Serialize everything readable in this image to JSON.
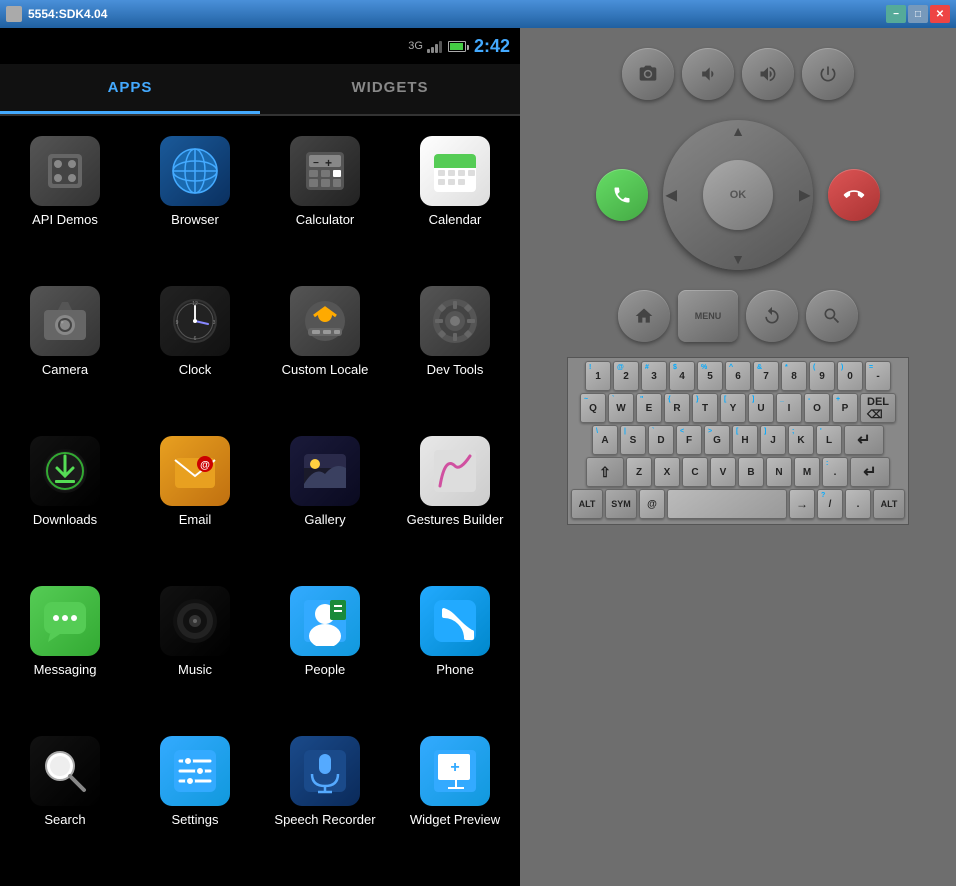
{
  "titlebar": {
    "title": "5554:SDK4.04",
    "min_label": "−",
    "max_label": "□",
    "close_label": "✕"
  },
  "status_bar": {
    "signal": "3G",
    "time": "2:42"
  },
  "tabs": [
    {
      "id": "apps",
      "label": "APPS",
      "active": true
    },
    {
      "id": "widgets",
      "label": "WIDGETS",
      "active": false
    }
  ],
  "apps": [
    {
      "id": "api-demos",
      "label": "API Demos"
    },
    {
      "id": "browser",
      "label": "Browser"
    },
    {
      "id": "calculator",
      "label": "Calculator"
    },
    {
      "id": "calendar",
      "label": "Calendar"
    },
    {
      "id": "camera",
      "label": "Camera"
    },
    {
      "id": "clock",
      "label": "Clock"
    },
    {
      "id": "custom-locale",
      "label": "Custom Locale"
    },
    {
      "id": "dev-tools",
      "label": "Dev Tools"
    },
    {
      "id": "downloads",
      "label": "Downloads"
    },
    {
      "id": "email",
      "label": "Email"
    },
    {
      "id": "gallery",
      "label": "Gallery"
    },
    {
      "id": "gestures-builder",
      "label": "Gestures Builder"
    },
    {
      "id": "messaging",
      "label": "Messaging"
    },
    {
      "id": "music",
      "label": "Music"
    },
    {
      "id": "people",
      "label": "People"
    },
    {
      "id": "phone",
      "label": "Phone"
    },
    {
      "id": "search",
      "label": "Search"
    },
    {
      "id": "settings",
      "label": "Settings"
    },
    {
      "id": "speech-recorder",
      "label": "Speech Recorder"
    },
    {
      "id": "widget-preview",
      "label": "Widget Preview"
    }
  ],
  "controls": {
    "camera_label": "📷",
    "vol_down_label": "🔉",
    "vol_up_label": "🔊",
    "power_label": "⏻",
    "call_label": "📞",
    "end_label": "📵",
    "home_label": "⌂",
    "menu_label": "MENU",
    "back_label": "↺",
    "search_label": "🔍"
  },
  "keyboard": {
    "rows": [
      [
        "!",
        "@",
        "#",
        "$",
        "%",
        "^",
        "&",
        "*",
        "(",
        ")",
        "-"
      ],
      [
        "1",
        "2",
        "3",
        "4",
        "5",
        "6",
        "7",
        "8",
        "9",
        "0",
        "="
      ],
      [
        "Q",
        "W",
        "E",
        "R",
        "T",
        "Y",
        "U",
        "I",
        "O",
        "P",
        "←"
      ],
      [
        "A",
        "S",
        "D",
        "F",
        "G",
        "H",
        "J",
        "K",
        "L",
        "⌫"
      ],
      [
        "⇧",
        "Z",
        "X",
        "C",
        "V",
        "B",
        "N",
        "M",
        ".",
        "↵"
      ],
      [
        "ALT",
        "SYM",
        "@",
        "SPACE",
        "→",
        "/",
        "?",
        ",",
        "ALT"
      ]
    ]
  }
}
